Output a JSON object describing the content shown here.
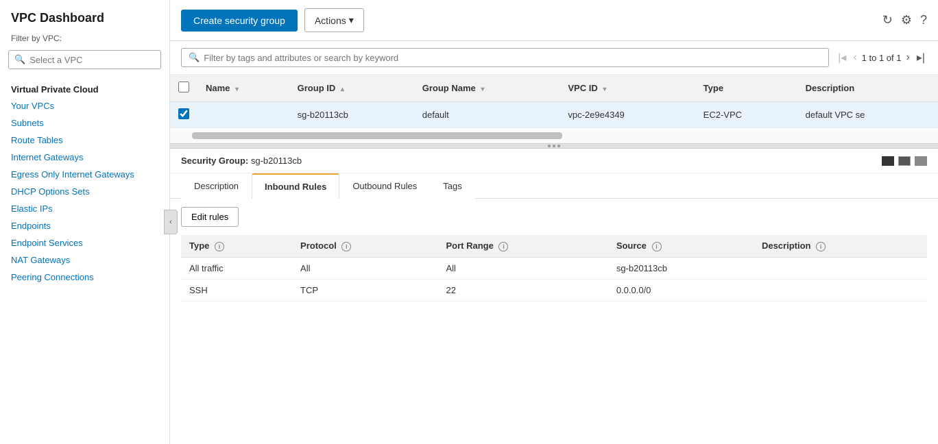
{
  "app": {
    "title": "VPC Dashboard"
  },
  "sidebar": {
    "title": "VPC Dashboard",
    "filter_label": "Filter by VPC:",
    "vpc_placeholder": "Select a VPC",
    "section_title": "Virtual Private Cloud",
    "items": [
      {
        "label": "Your VPCs"
      },
      {
        "label": "Subnets"
      },
      {
        "label": "Route Tables"
      },
      {
        "label": "Internet Gateways"
      },
      {
        "label": "Egress Only Internet Gateways"
      },
      {
        "label": "DHCP Options Sets"
      },
      {
        "label": "Elastic IPs"
      },
      {
        "label": "Endpoints"
      },
      {
        "label": "Endpoint Services"
      },
      {
        "label": "NAT Gateways"
      },
      {
        "label": "Peering Connections"
      }
    ]
  },
  "toolbar": {
    "create_label": "Create security group",
    "actions_label": "Actions",
    "icons": {
      "refresh": "↻",
      "settings": "⚙",
      "help": "?"
    }
  },
  "search": {
    "placeholder": "Filter by tags and attributes or search by keyword"
  },
  "pagination": {
    "text": "1 to 1 of 1"
  },
  "table": {
    "columns": [
      "Name",
      "Group ID",
      "Group Name",
      "VPC ID",
      "Type",
      "Description"
    ],
    "rows": [
      {
        "selected": true,
        "name": "",
        "group_id": "sg-b20113cb",
        "group_name": "default",
        "vpc_id": "vpc-2e9e4349",
        "type": "EC2-VPC",
        "description": "default VPC se"
      }
    ]
  },
  "details": {
    "security_group_label": "Security Group:",
    "security_group_id": "sg-b20113cb",
    "tabs": [
      "Description",
      "Inbound Rules",
      "Outbound Rules",
      "Tags"
    ],
    "active_tab": "Inbound Rules",
    "edit_rules_label": "Edit rules",
    "rules_columns": [
      "Type",
      "Protocol",
      "Port Range",
      "Source",
      "Description"
    ],
    "rules_rows": [
      {
        "type": "All traffic",
        "protocol": "All",
        "port_range": "All",
        "source": "sg-b20113cb",
        "description": ""
      },
      {
        "type": "SSH",
        "protocol": "TCP",
        "port_range": "22",
        "source": "0.0.0.0/0",
        "description": ""
      }
    ]
  }
}
